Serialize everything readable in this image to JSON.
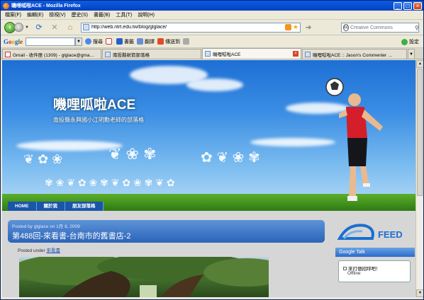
{
  "window": {
    "title": "嘰哩呱啦ACE - Mozilla Firefox"
  },
  "menu": [
    "檔案(F)",
    "編輯(E)",
    "檢視(V)",
    "歷史(S)",
    "書籤(B)",
    "工具(T)",
    "說明(H)"
  ],
  "nav": {
    "url": "http://web.ntrt.edu.tw/blog/glglace/",
    "search_placeholder": "Creative Commons"
  },
  "google_toolbar": {
    "search_label": "搜尋",
    "bookmarks_label": "書籤",
    "translate_label": "翻譯",
    "sendto_label": "傳送到",
    "settings_label": "設定"
  },
  "tabs": [
    {
      "label": "Gmail - 收件匣 (1309) - glglace@gma…",
      "active": false
    },
    {
      "label": "南投縣射箭部落格",
      "active": false
    },
    {
      "label": "嘰哩呱啦ACE",
      "active": true
    },
    {
      "label": "嘰哩呱啦ACE :: Jason's Commenter …",
      "active": false
    }
  ],
  "blog": {
    "title": "嘰哩呱啦ACE",
    "subtitle": "南投縣永興國小江明勳老師的部落格",
    "nav": [
      "HOME",
      "關於我",
      "朋友部落格"
    ]
  },
  "post": {
    "meta": "Posted by glglace on 1月 8, 2009",
    "title": "第488回-來看書-台南市的舊書店-2",
    "under_label": "Posted under",
    "category": "來看書"
  },
  "sidebar": {
    "feed_label": "FEED",
    "gtalk_title": "Google Talk",
    "gtalk_name": "來打個招呼吧！",
    "gtalk_status": "Offline"
  },
  "colors": {
    "titlebar": "#0a5ce6",
    "post_header": "#2b64b9",
    "link": "#1a56a8"
  }
}
